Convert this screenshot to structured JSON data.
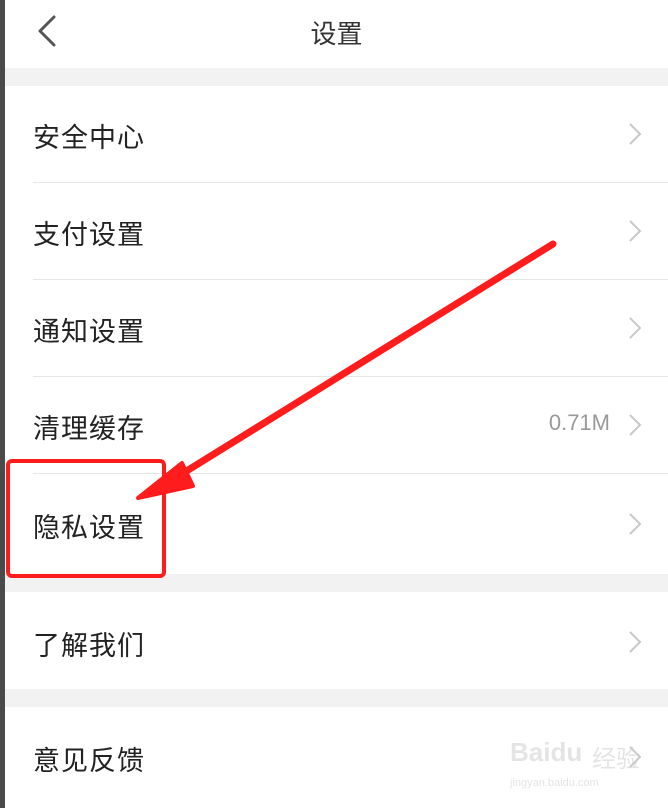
{
  "header": {
    "title": "设置",
    "back_icon": "chevron-left-icon"
  },
  "groups": [
    {
      "items": [
        {
          "label": "安全中心",
          "value": ""
        },
        {
          "label": "支付设置",
          "value": ""
        },
        {
          "label": "通知设置",
          "value": ""
        },
        {
          "label": "清理缓存",
          "value": "0.71M"
        },
        {
          "label": "隐私设置",
          "value": ""
        }
      ]
    },
    {
      "items": [
        {
          "label": "了解我们",
          "value": ""
        }
      ]
    },
    {
      "items": [
        {
          "label": "意见反馈",
          "value": ""
        }
      ]
    }
  ],
  "annotation": {
    "color": "#ff1c1c",
    "highlighted_item": "隐私设置"
  },
  "watermark": {
    "brand": "Baidu",
    "brand_cn": "经验",
    "url": "jingyan.baidu.com"
  }
}
